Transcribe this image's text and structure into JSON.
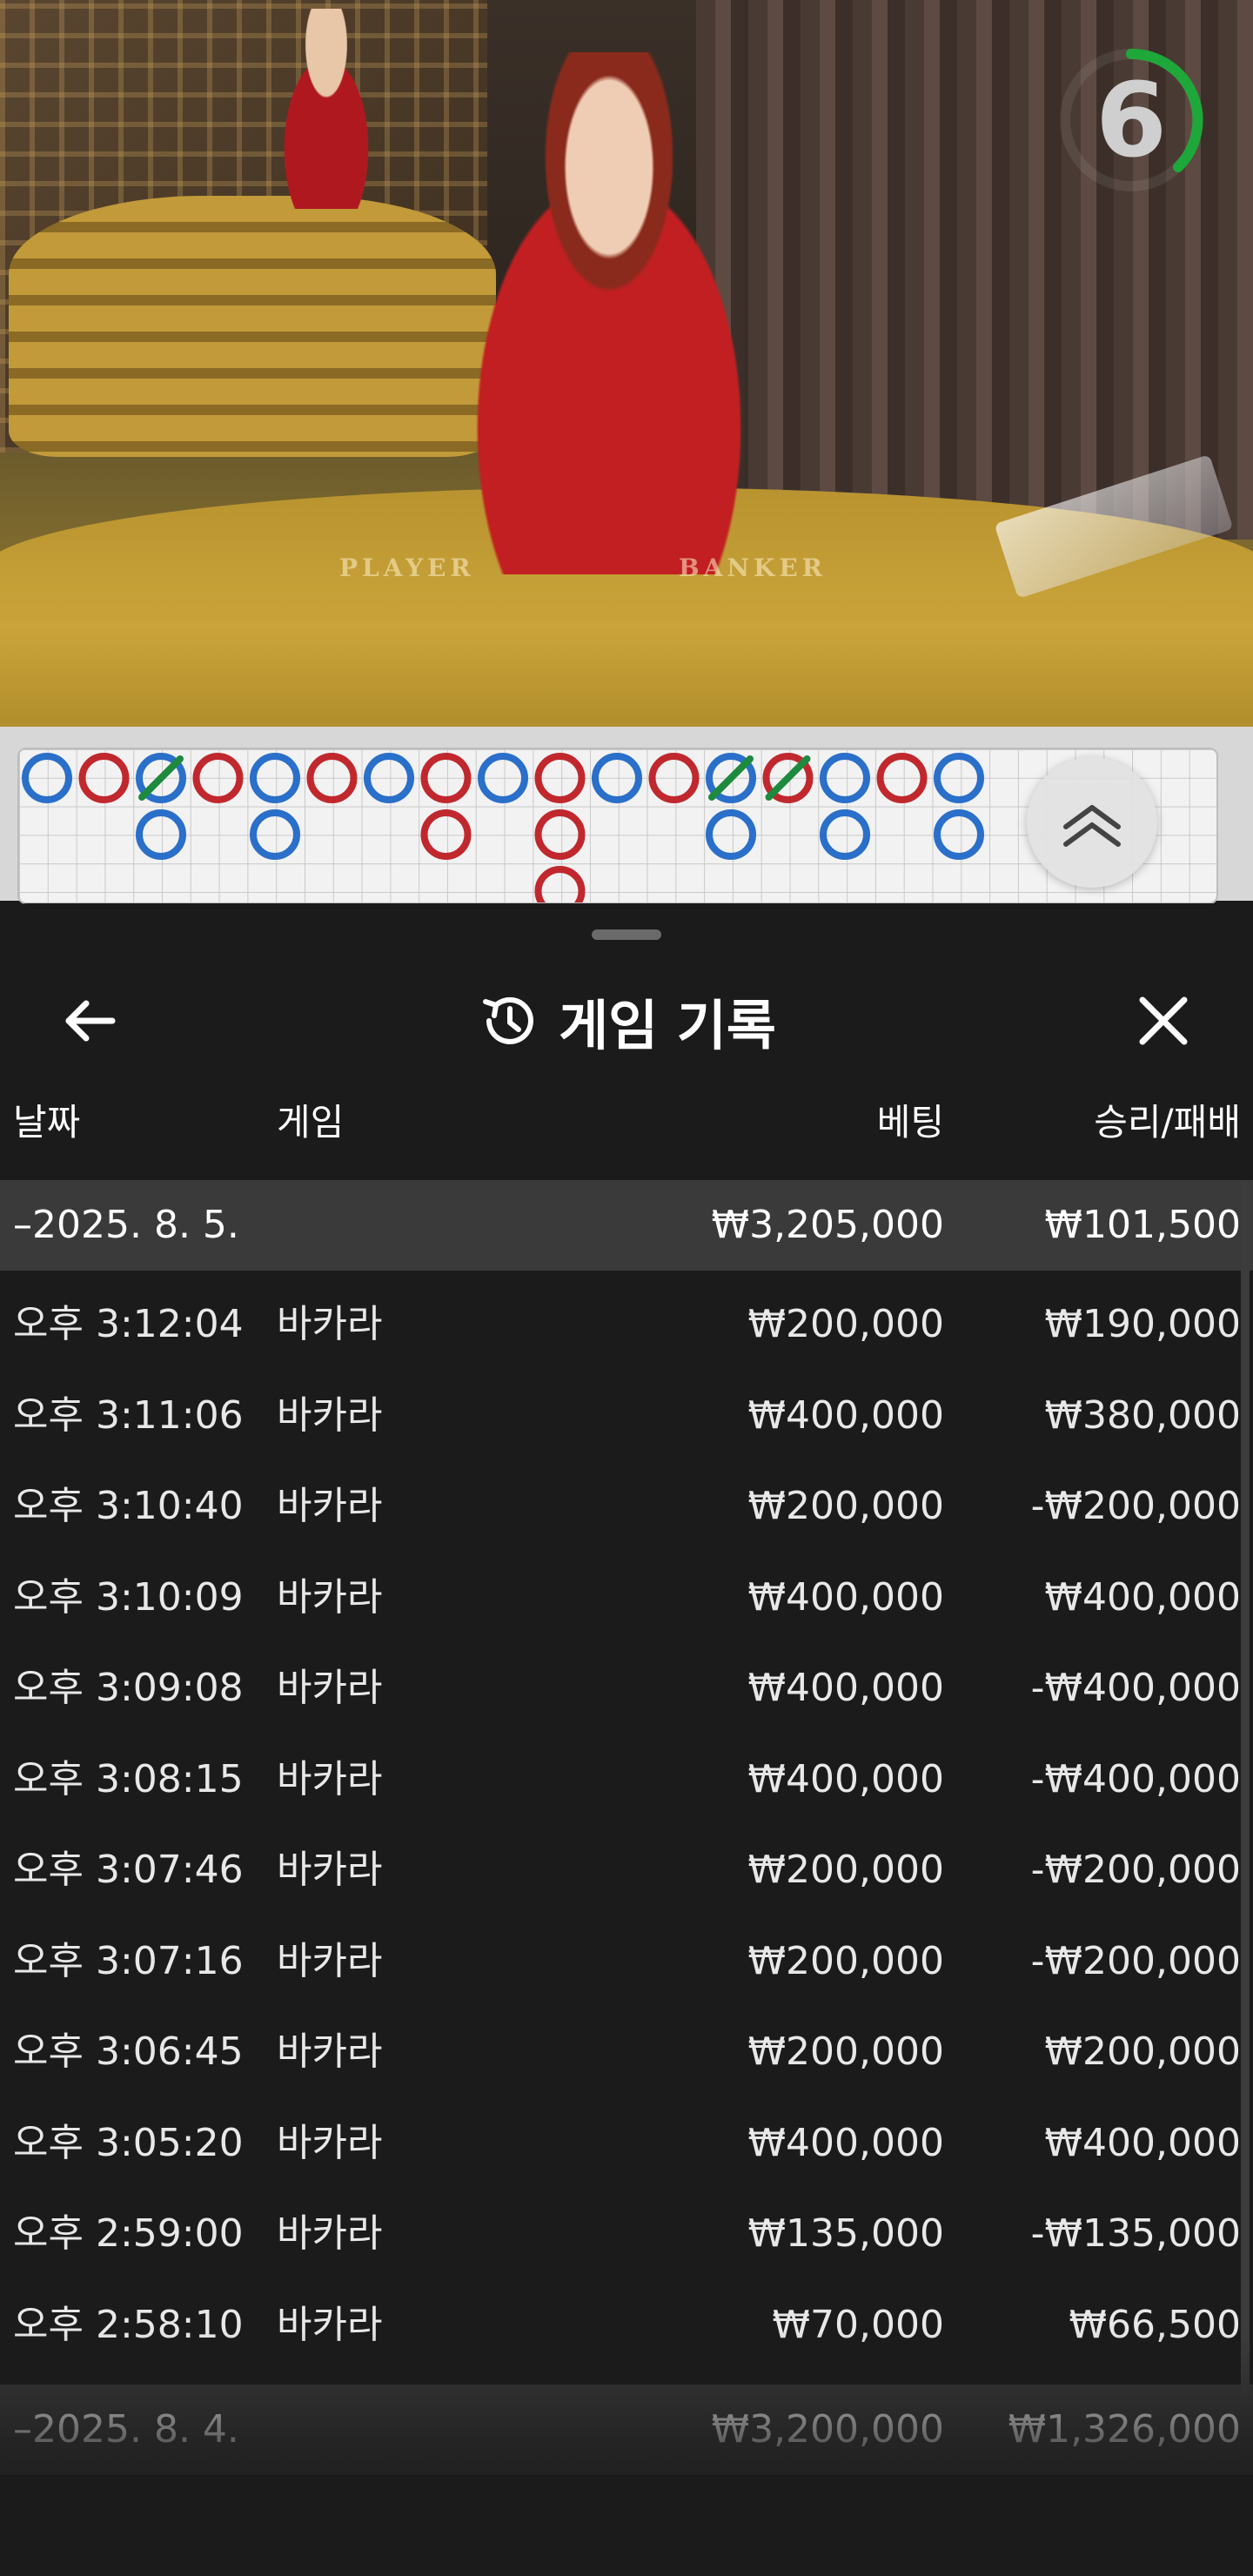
{
  "video": {
    "timer": "6",
    "felt_player": "PLAYER",
    "felt_banker": "BANKER"
  },
  "roadmap": {
    "columns": [
      [
        "B"
      ],
      [
        "R"
      ],
      [
        "BX",
        "B"
      ],
      [
        "R"
      ],
      [
        "B",
        "B"
      ],
      [
        "R"
      ],
      [
        "B"
      ],
      [
        "R",
        "R"
      ],
      [
        "B"
      ],
      [
        "R",
        "R",
        "R"
      ],
      [
        "B"
      ],
      [
        "R"
      ],
      [
        "BX",
        "B"
      ],
      [
        "RX"
      ],
      [
        "B",
        "B"
      ],
      [
        "R"
      ],
      [
        "B",
        "B"
      ]
    ]
  },
  "sheet": {
    "title": "게임 기록",
    "headers": {
      "date": "날짜",
      "game": "게임",
      "bet": "베팅",
      "result": "승리/패배"
    },
    "groups": [
      {
        "date": "–2025. 8. 5.",
        "bet": "₩3,205,000",
        "result": "₩101,500",
        "rows": [
          {
            "time": "오후 3:12:04",
            "game": "바카라",
            "bet": "₩200,000",
            "result": "₩190,000"
          },
          {
            "time": "오후 3:11:06",
            "game": "바카라",
            "bet": "₩400,000",
            "result": "₩380,000"
          },
          {
            "time": "오후 3:10:40",
            "game": "바카라",
            "bet": "₩200,000",
            "result": "-₩200,000"
          },
          {
            "time": "오후 3:10:09",
            "game": "바카라",
            "bet": "₩400,000",
            "result": "₩400,000"
          },
          {
            "time": "오후 3:09:08",
            "game": "바카라",
            "bet": "₩400,000",
            "result": "-₩400,000"
          },
          {
            "time": "오후 3:08:15",
            "game": "바카라",
            "bet": "₩400,000",
            "result": "-₩400,000"
          },
          {
            "time": "오후 3:07:46",
            "game": "바카라",
            "bet": "₩200,000",
            "result": "-₩200,000"
          },
          {
            "time": "오후 3:07:16",
            "game": "바카라",
            "bet": "₩200,000",
            "result": "-₩200,000"
          },
          {
            "time": "오후 3:06:45",
            "game": "바카라",
            "bet": "₩200,000",
            "result": "₩200,000"
          },
          {
            "time": "오후 3:05:20",
            "game": "바카라",
            "bet": "₩400,000",
            "result": "₩400,000"
          },
          {
            "time": "오후 2:59:00",
            "game": "바카라",
            "bet": "₩135,000",
            "result": "-₩135,000"
          },
          {
            "time": "오후 2:58:10",
            "game": "바카라",
            "bet": "₩70,000",
            "result": "₩66,500"
          }
        ]
      },
      {
        "date": "–2025. 8. 4.",
        "bet": "₩3,200,000",
        "result": "₩1,326,000",
        "rows": []
      }
    ]
  },
  "colors": {
    "banker_blue": "#2a6fc9",
    "player_red": "#c0282e",
    "tie_green": "#1d8a3e",
    "timer_green": "#1fa83a"
  }
}
